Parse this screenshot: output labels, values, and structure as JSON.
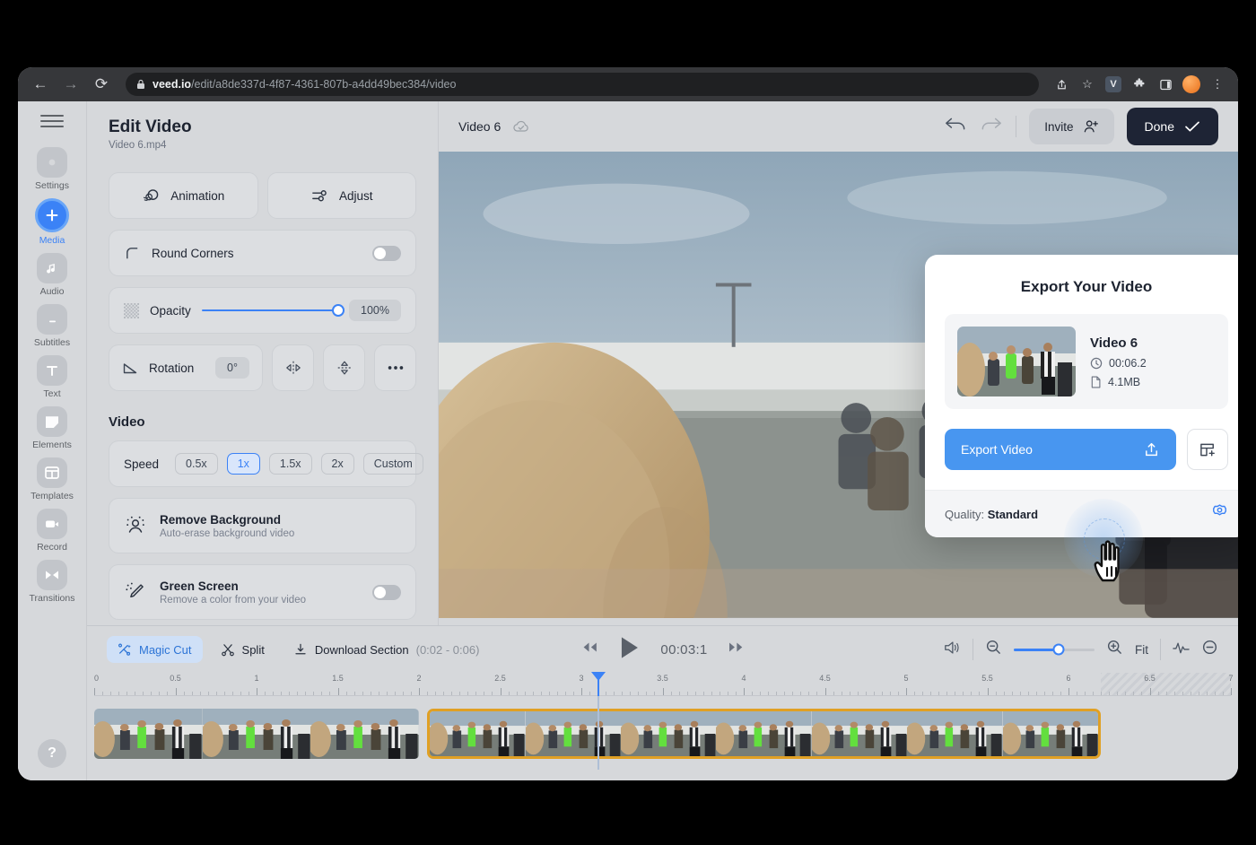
{
  "browser": {
    "url_domain": "veed.io",
    "url_path": "/edit/a8de337d-4f87-4361-807b-a4dd49bec384/video",
    "back_icon": "←",
    "forward_icon": "→",
    "reload_icon": "⟳",
    "lock_icon": "🔒",
    "share_icon": "share-icon",
    "star_icon": "☆",
    "extension_v": "V",
    "puzzle_icon": "puzzle-icon",
    "sidepanel_icon": "sidepanel-icon",
    "menu_icon": "⋮"
  },
  "rail": {
    "menu_label": "menu",
    "items": [
      {
        "label": "Settings",
        "icon": "settings-icon",
        "active": false
      },
      {
        "label": "Media",
        "icon": "plus-icon",
        "active": true
      },
      {
        "label": "Audio",
        "icon": "music-note-icon",
        "active": false
      },
      {
        "label": "Subtitles",
        "icon": "subtitles-icon",
        "active": false
      },
      {
        "label": "Text",
        "icon": "text-icon",
        "active": false
      },
      {
        "label": "Elements",
        "icon": "elements-icon",
        "active": false
      },
      {
        "label": "Templates",
        "icon": "templates-icon",
        "active": false
      },
      {
        "label": "Record",
        "icon": "record-camera-icon",
        "active": false
      },
      {
        "label": "Transitions",
        "icon": "transitions-icon",
        "active": false
      }
    ],
    "help_label": "?"
  },
  "panel": {
    "title": "Edit Video",
    "subtitle": "Video 6.mp4",
    "animation_label": "Animation",
    "adjust_label": "Adjust",
    "round_corners_label": "Round Corners",
    "round_corners_state": "off",
    "opacity_label": "Opacity",
    "opacity_value": "100%",
    "rotation_label": "Rotation",
    "rotation_value": "0°",
    "flip_h_label": "flip-horizontal",
    "flip_v_label": "flip-vertical",
    "more_label": "•••",
    "video_section": "Video",
    "speed_label": "Speed",
    "speed_options": [
      "0.5x",
      "1x",
      "1.5x",
      "2x",
      "Custom"
    ],
    "speed_selected": "1x",
    "remove_bg_title": "Remove Background",
    "remove_bg_sub": "Auto-erase background video",
    "green_screen_title": "Green Screen",
    "green_screen_sub": "Remove a color from your video",
    "green_screen_state": "off"
  },
  "stage": {
    "title": "Video 6",
    "cloud_status_icon": "cloud-check-icon",
    "undo_icon": "undo-icon",
    "redo_icon": "redo-icon",
    "invite_label": "Invite",
    "done_label": "Done"
  },
  "timeline": {
    "magic_cut_label": "Magic Cut",
    "split_label": "Split",
    "download_section_label": "Download Section",
    "download_section_range": "(0:02 - 0:06)",
    "skip_back_icon": "⏪",
    "play_icon": "play-icon",
    "skip_fwd_icon": "⏩",
    "timecode": "00:03:1",
    "volume_icon": "volume-icon",
    "zoom_out_icon": "zoom-out-icon",
    "zoom_in_icon": "zoom-in-icon",
    "fit_label": "Fit",
    "waveform_icon": "waveform-icon",
    "collapse_icon": "collapse-icon",
    "ruler_ticks": [
      "0",
      "0.5",
      "1",
      "1.5",
      "2",
      "2.5",
      "3",
      "3.5",
      "4",
      "4.5",
      "5",
      "5.5",
      "6",
      "6.5",
      "7"
    ],
    "ruler_max": 7,
    "playhead_time": 3.1,
    "content_end": 6.2,
    "clips": [
      {
        "start": 0,
        "end": 2.0,
        "selected": false
      },
      {
        "start": 2.05,
        "end": 6.2,
        "selected": true
      }
    ],
    "zoom_level_pct": 55
  },
  "export": {
    "title": "Export Your Video",
    "video_name": "Video 6",
    "duration": "00:06.2",
    "filesize": "4.1MB",
    "duration_icon": "clock-icon",
    "file_icon": "file-icon",
    "export_button_label": "Export Video",
    "export_icon": "upload-icon",
    "alt_button_icon": "add-layout-icon",
    "quality_label": "Quality:",
    "quality_value": "Standard",
    "settings_icon": "gear-icon"
  },
  "colors": {
    "accent_blue": "#3b82f6",
    "export_blue": "#4896f0",
    "selection_amber": "#e0a024",
    "done_dark": "#1e2435",
    "app_bg": "#d6d8db"
  }
}
